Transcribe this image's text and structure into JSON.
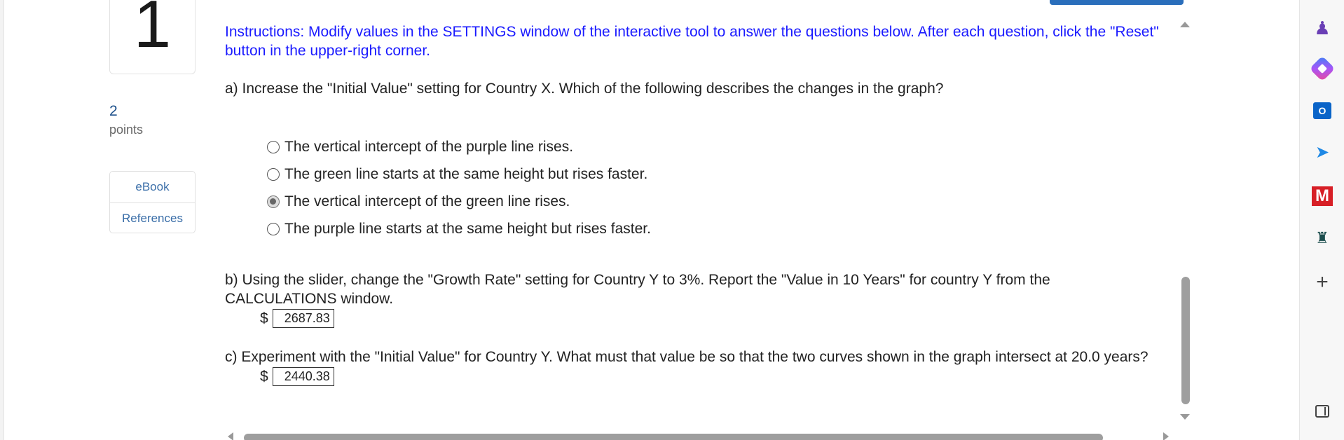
{
  "question": {
    "number": "1",
    "points_value": "2",
    "points_label": "points"
  },
  "resources": {
    "ebook": "eBook",
    "references": "References"
  },
  "instructions": "Instructions: Modify values in the SETTINGS window of the interactive tool to answer the questions below.  After each question, click the \"Reset\" button in the upper-right corner.",
  "part_a": {
    "prompt": "a) Increase the \"Initial Value\" setting for Country X.  Which of the following describes the changes in the graph?",
    "options": [
      {
        "label": "The vertical intercept of the purple line rises.",
        "selected": false
      },
      {
        "label": "The green line starts at the same height but rises faster.",
        "selected": false
      },
      {
        "label": "The vertical intercept of the green line rises.",
        "selected": true
      },
      {
        "label": "The purple line starts at the same height but rises faster.",
        "selected": false
      }
    ]
  },
  "part_b": {
    "prompt": "b) Using the slider, change the \"Growth Rate\" setting for Country Y to 3%.  Report the \"Value in 10 Years\" for country Y from the CALCULATIONS window.",
    "currency": "$",
    "answer": "2687.83"
  },
  "part_c": {
    "prompt": "c) Experiment with the \"Initial Value\" for Country Y.  What must that value be so that the two curves shown in the graph intersect at 20.0 years?",
    "currency": "$",
    "answer": "2440.38"
  },
  "sidebar_icons": [
    "chess-icon",
    "copilot-icon",
    "outlook-icon",
    "send-icon",
    "m-app-icon",
    "game-icon",
    "add-icon",
    "sidebar-toggle-icon"
  ],
  "colors": {
    "instructions_text": "#1a1aff",
    "accent_blue": "#2a6ebb",
    "link_blue": "#3a6ea8"
  }
}
